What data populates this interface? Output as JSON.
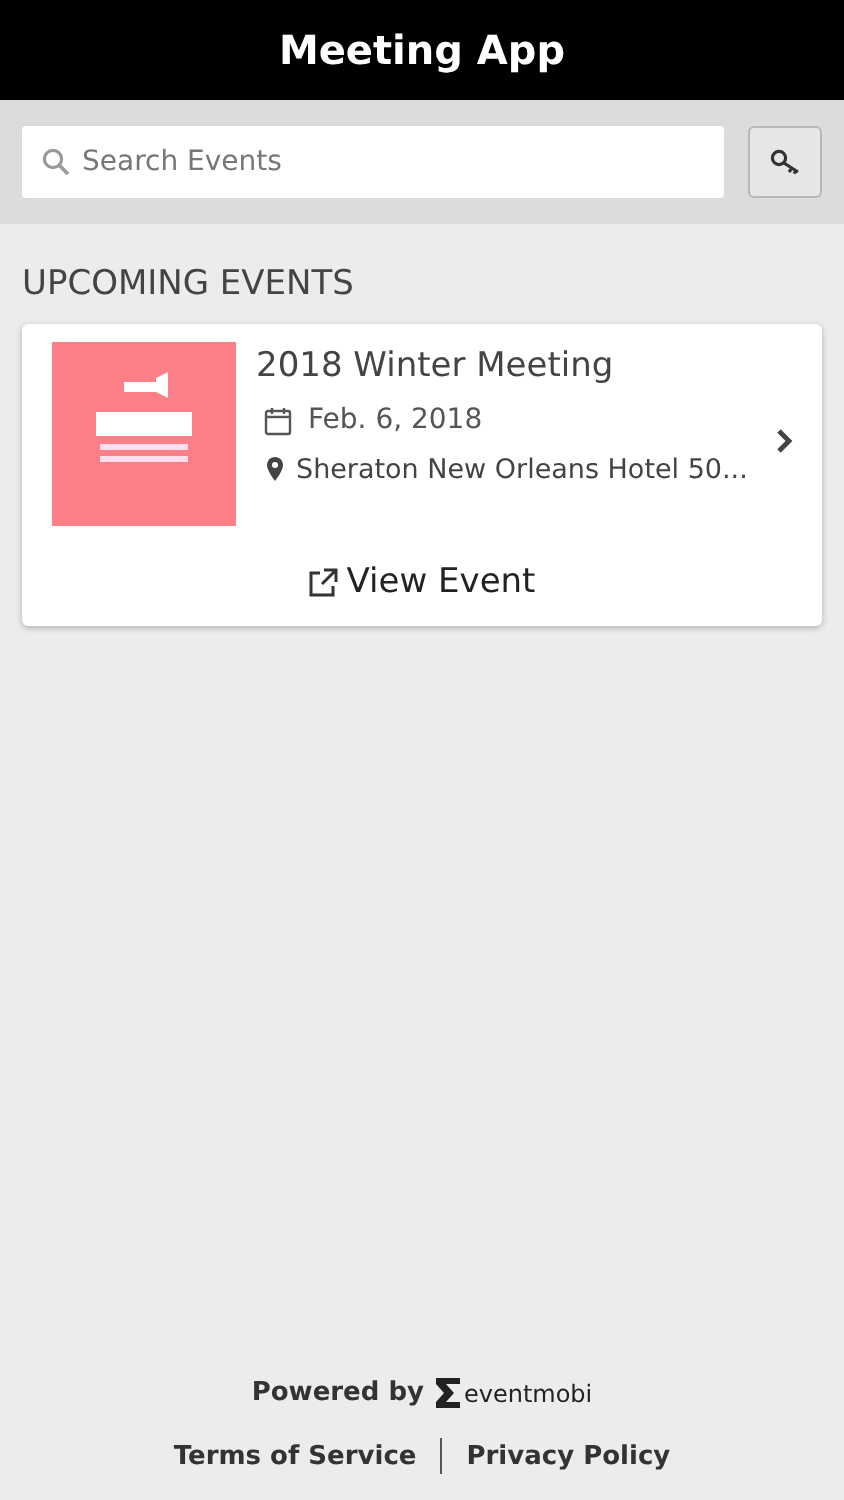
{
  "header": {
    "title": "Meeting App"
  },
  "search": {
    "placeholder": "Search Events"
  },
  "section_title": "UPCOMING EVENTS",
  "events": [
    {
      "kind": "picture",
      "title": "2018 Winter Meeting",
      "date": "Feb. 6, 2018",
      "location": "Sheraton New Orleans Hotel 50...",
      "action": "View Event"
    }
  ],
  "footer": {
    "powered_by": "Powered by",
    "brand": "eventmobi",
    "links": [
      "Terms of Service",
      "Privacy Policy"
    ]
  }
}
